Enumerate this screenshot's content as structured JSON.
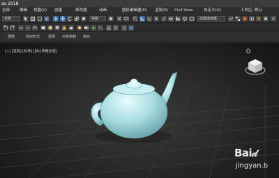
{
  "window": {
    "title": "ax 2018"
  },
  "menubar": {
    "items": [
      "全部",
      "编辑",
      "视图(V)",
      "创建",
      "修改器",
      "动画",
      "图形编辑器(D)",
      "渲染(R)",
      "Civil View",
      "自定义(U)"
    ],
    "workspace": "工作区: 默认"
  },
  "toolbar": {
    "selection_filter": "全部",
    "reference_coord": "视图",
    "named_selection": "创建选择集"
  },
  "ribbon": {
    "tabs": [
      "建模",
      "自由形式",
      "选择",
      "对象绘制",
      "填充"
    ]
  },
  "viewport": {
    "label": "[+] [透视] [标准] [默认明暗处理]"
  },
  "watermark": {
    "logo": "Bai𝒹",
    "site": "jingyan.b"
  },
  "colors": {
    "viewport_bg": "#2a2a2a",
    "teapot": "#a9dde2",
    "menubar": "#2e2e2e"
  }
}
